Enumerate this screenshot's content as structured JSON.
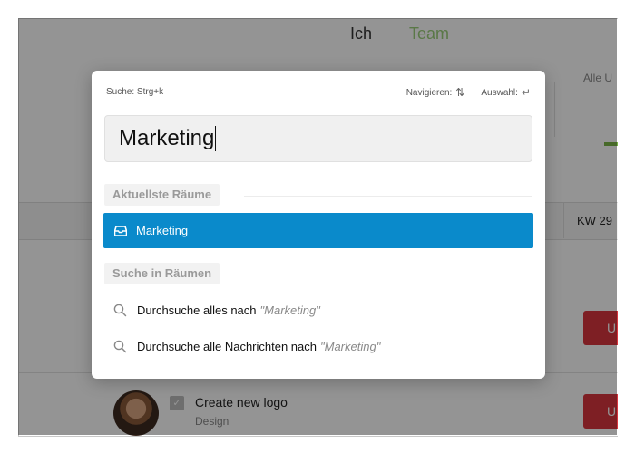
{
  "background": {
    "header_left": "Ich",
    "header_right": "Team",
    "column_label": "Alle U",
    "week_label": "KW 29",
    "red_button_label": "U",
    "task": {
      "title": "Create new logo",
      "tag": "Design"
    }
  },
  "modal": {
    "hint_search": "Suche: Strg+k",
    "hint_navigate": "Navigieren:",
    "hint_select": "Auswahl:",
    "search_value": "Marketing",
    "recent_section_label": "Aktuellste Räume",
    "recent_items": [
      {
        "label": "Marketing",
        "icon": "inbox-icon",
        "selected": true
      }
    ],
    "rooms_section_label": "Suche in Räumen",
    "search_options": [
      {
        "prefix": "Durchsuche alles nach",
        "query": "\"Marketing\"",
        "icon": "search-icon"
      },
      {
        "prefix": "Durchsuche alle Nachrichten nach",
        "query": "\"Marketing\"",
        "icon": "search-icon"
      }
    ]
  },
  "colors": {
    "accent": "#0a8acb",
    "danger": "#d9363e",
    "progress": "#7ab648"
  }
}
